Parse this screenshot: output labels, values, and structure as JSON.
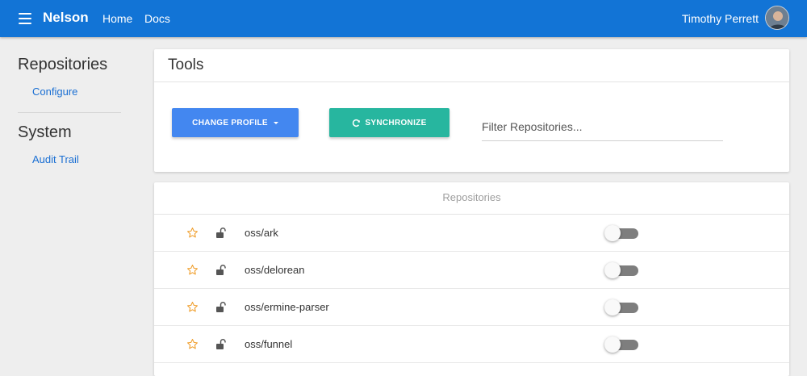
{
  "header": {
    "menu_icon": "hamburger-menu-icon",
    "brand": "Nelson",
    "nav": [
      {
        "label": "Home"
      },
      {
        "label": "Docs"
      }
    ],
    "user_name": "Timothy Perrett",
    "background_color": "#1274d6"
  },
  "sidebar": {
    "sections": [
      {
        "heading": "Repositories",
        "links": [
          {
            "label": "Configure"
          }
        ]
      },
      {
        "heading": "System",
        "links": [
          {
            "label": "Audit Trail"
          }
        ]
      }
    ],
    "link_color": "#1a6fd3"
  },
  "tools": {
    "title": "Tools",
    "change_profile_label": "CHANGE PROFILE",
    "change_profile_color": "#4387f0",
    "synchronize_label": "SYNCHRONIZE",
    "synchronize_icon": "refresh-icon",
    "synchronize_color": "#27b69f",
    "filter_placeholder": "Filter Repositories..."
  },
  "repositories": {
    "header": "Repositories",
    "star_color": "#f0a030",
    "rows": [
      {
        "name": "oss/ark",
        "starred": false,
        "locked": false,
        "enabled": false
      },
      {
        "name": "oss/delorean",
        "starred": false,
        "locked": false,
        "enabled": false
      },
      {
        "name": "oss/ermine-parser",
        "starred": false,
        "locked": false,
        "enabled": false
      },
      {
        "name": "oss/funnel",
        "starred": false,
        "locked": false,
        "enabled": false
      }
    ]
  }
}
